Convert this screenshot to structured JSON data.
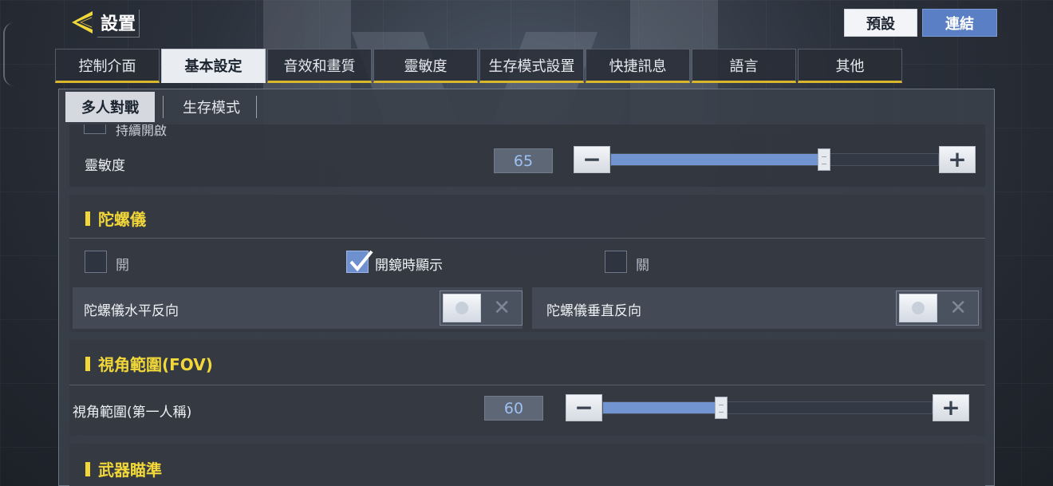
{
  "header": {
    "back_icon": "back-arrow-icon",
    "title": "設置",
    "preset_label": "預設",
    "link_label": "連結"
  },
  "tabs": [
    {
      "label": "控制介面",
      "active": false
    },
    {
      "label": "基本設定",
      "active": true
    },
    {
      "label": "音效和畫質",
      "active": false
    },
    {
      "label": "靈敏度",
      "active": false
    },
    {
      "label": "生存模式設置",
      "active": false
    },
    {
      "label": "快捷訊息",
      "active": false
    },
    {
      "label": "語言",
      "active": false
    },
    {
      "label": "其他",
      "active": false
    }
  ],
  "subtabs": [
    {
      "label": "多人對戰",
      "active": true
    },
    {
      "label": "生存模式",
      "active": false
    }
  ],
  "sensitivity": {
    "clipped_label": "持續開啟",
    "label": "靈敏度",
    "value": "65",
    "fill_fraction": 0.65,
    "minus_icon": "minus-icon",
    "plus_icon": "plus-icon"
  },
  "gyroscope": {
    "title": "陀螺儀",
    "options": [
      {
        "label": "開",
        "checked": false
      },
      {
        "label": "開鏡時顯示",
        "checked": true
      },
      {
        "label": "關",
        "checked": false
      }
    ],
    "horizontal_invert_label": "陀螺儀水平反向",
    "vertical_invert_label": "陀螺儀垂直反向",
    "horizontal_invert_on": false,
    "vertical_invert_on": false
  },
  "fov": {
    "title": "視角範圍(FOV)",
    "label": "視角範圍(第一人稱)",
    "value": "60",
    "fill_fraction": 0.36
  },
  "weapon_aim": {
    "title": "武器瞄準"
  },
  "colors": {
    "accent_yellow": "#f1d739",
    "slider_blue": "#7295d2",
    "link_blue": "#5b7fc4"
  }
}
